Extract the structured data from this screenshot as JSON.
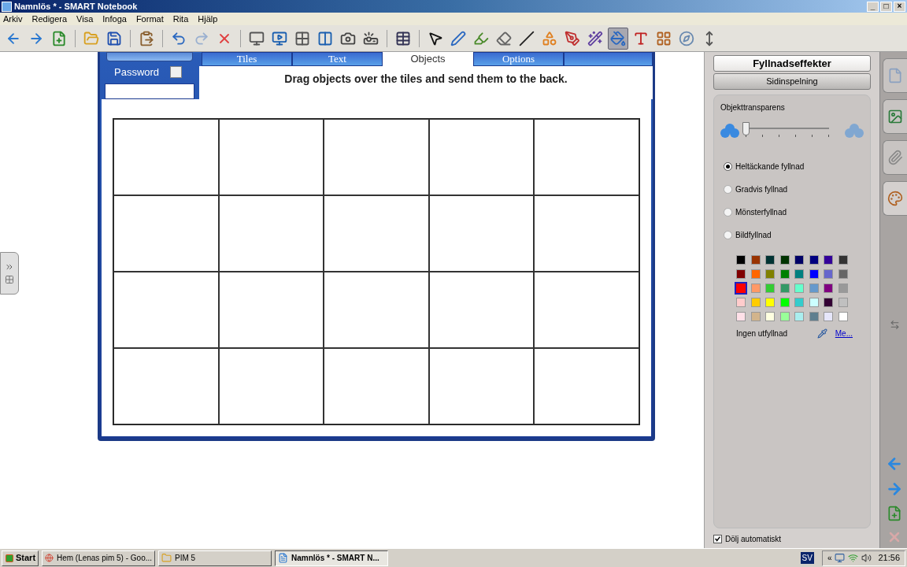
{
  "window": {
    "title": "Namnlös * - SMART Notebook",
    "controls": [
      "_",
      "□",
      "×"
    ]
  },
  "menu": [
    "Arkiv",
    "Redigera",
    "Visa",
    "Infoga",
    "Format",
    "Rita",
    "Hjälp"
  ],
  "toolbar": [
    {
      "kind": "back",
      "selected": false
    },
    {
      "kind": "forward",
      "selected": false
    },
    {
      "kind": "add-page",
      "selected": false
    },
    {
      "kind": "sep"
    },
    {
      "kind": "open",
      "selected": false
    },
    {
      "kind": "save",
      "selected": false
    },
    {
      "kind": "sep"
    },
    {
      "kind": "paste",
      "selected": false
    },
    {
      "kind": "sep"
    },
    {
      "kind": "undo",
      "selected": false
    },
    {
      "kind": "redo",
      "selected": false
    },
    {
      "kind": "delete",
      "selected": false
    },
    {
      "kind": "sep"
    },
    {
      "kind": "screen-shade",
      "selected": false
    },
    {
      "kind": "monitor",
      "selected": false
    },
    {
      "kind": "monitor-grid",
      "selected": false
    },
    {
      "kind": "monitor-split",
      "selected": false
    },
    {
      "kind": "camera",
      "selected": false
    },
    {
      "kind": "document-camera",
      "selected": false
    },
    {
      "kind": "sep"
    },
    {
      "kind": "table",
      "selected": false
    },
    {
      "kind": "sep"
    },
    {
      "kind": "select",
      "selected": false
    },
    {
      "kind": "pen",
      "selected": false
    },
    {
      "kind": "highlighter",
      "selected": false
    },
    {
      "kind": "eraser",
      "selected": false
    },
    {
      "kind": "line",
      "selected": false
    },
    {
      "kind": "shapes",
      "selected": false
    },
    {
      "kind": "shape-pen",
      "selected": false
    },
    {
      "kind": "magic-pen",
      "selected": false
    },
    {
      "kind": "fill",
      "selected": true
    },
    {
      "kind": "text",
      "selected": false
    },
    {
      "kind": "properties",
      "selected": false
    },
    {
      "kind": "measure",
      "selected": false
    },
    {
      "kind": "move-toolbar",
      "selected": false
    }
  ],
  "widget": {
    "password_label": "Password",
    "password_checked": false,
    "tabs": [
      {
        "label": "Tiles",
        "selected": false
      },
      {
        "label": "Text",
        "selected": false
      },
      {
        "label": "Objects",
        "selected": true
      },
      {
        "label": "Options",
        "selected": false
      }
    ],
    "instruction": "Drag objects over the tiles and send them to the back."
  },
  "panel": {
    "header_buttons": [
      {
        "label": "Fyllnadseffekter",
        "selected": true
      },
      {
        "label": "Sidinspelning",
        "selected": false
      }
    ],
    "transparency": {
      "label": "Objekttransparens",
      "level": 0.0
    },
    "fill_options": [
      {
        "label": "Heltäckande fyllnad",
        "selected": true
      },
      {
        "label": "Gradvis fyllnad",
        "selected": false
      },
      {
        "label": "Mönsterfyllnad",
        "selected": false
      },
      {
        "label": "Bildfyllnad",
        "selected": false
      }
    ],
    "colors": [
      {
        "color": "#000000",
        "selected": false
      },
      {
        "color": "#993300",
        "selected": false
      },
      {
        "color": "#003333",
        "selected": false
      },
      {
        "color": "#003300",
        "selected": false
      },
      {
        "color": "#000066",
        "selected": false
      },
      {
        "color": "#000080",
        "selected": false
      },
      {
        "color": "#330099",
        "selected": false
      },
      {
        "color": "#333333",
        "selected": false
      },
      {
        "color": "#800000",
        "selected": false
      },
      {
        "color": "#ff6600",
        "selected": false
      },
      {
        "color": "#808000",
        "selected": false
      },
      {
        "color": "#008000",
        "selected": false
      },
      {
        "color": "#008080",
        "selected": false
      },
      {
        "color": "#0000ff",
        "selected": false
      },
      {
        "color": "#6666cc",
        "selected": false
      },
      {
        "color": "#666666",
        "selected": false
      },
      {
        "color": "#ff0000",
        "selected": true
      },
      {
        "color": "#ff9966",
        "selected": false
      },
      {
        "color": "#33cc33",
        "selected": false
      },
      {
        "color": "#339966",
        "selected": false
      },
      {
        "color": "#66ffcc",
        "selected": false
      },
      {
        "color": "#6699cc",
        "selected": false
      },
      {
        "color": "#800080",
        "selected": false
      },
      {
        "color": "#999999",
        "selected": false
      },
      {
        "color": "#ffcccc",
        "selected": false
      },
      {
        "color": "#ffcc00",
        "selected": false
      },
      {
        "color": "#ffff00",
        "selected": false
      },
      {
        "color": "#00ff00",
        "selected": false
      },
      {
        "color": "#33cccc",
        "selected": false
      },
      {
        "color": "#ccffff",
        "selected": false
      },
      {
        "color": "#330033",
        "selected": false
      },
      {
        "color": "#c0c0c0",
        "selected": false
      },
      {
        "color": "#ffe0e8",
        "selected": false
      },
      {
        "color": "#d2b48c",
        "selected": false
      },
      {
        "color": "#ffffe0",
        "selected": false
      },
      {
        "color": "#99ff99",
        "selected": false
      },
      {
        "color": "#aaeeee",
        "selected": false
      },
      {
        "color": "#5f7f8f",
        "selected": false
      },
      {
        "color": "#e6e6fa",
        "selected": false
      },
      {
        "color": "#ffffff",
        "selected": false
      }
    ],
    "no_fill": "Ingen utfyllnad",
    "more_link": "Me...",
    "auto_hide": {
      "label": "Dölj automatiskt",
      "checked": true
    }
  },
  "side_tabs": [
    {
      "kind": "pages",
      "selected": false
    },
    {
      "kind": "gallery",
      "selected": false
    },
    {
      "kind": "attachments",
      "selected": false
    },
    {
      "kind": "properties",
      "selected": true
    }
  ],
  "taskbar": {
    "start": "Start",
    "tasks": [
      {
        "label": "Hem (Lenas pim 5) - Goo...",
        "kind": "browser",
        "selected": false
      },
      {
        "label": "PIM 5",
        "kind": "folder",
        "selected": false
      },
      {
        "label": "Namnlös * - SMART N...",
        "kind": "notebook",
        "selected": true
      }
    ],
    "language": "SV",
    "tray_expand": "«",
    "time": "21:56"
  }
}
